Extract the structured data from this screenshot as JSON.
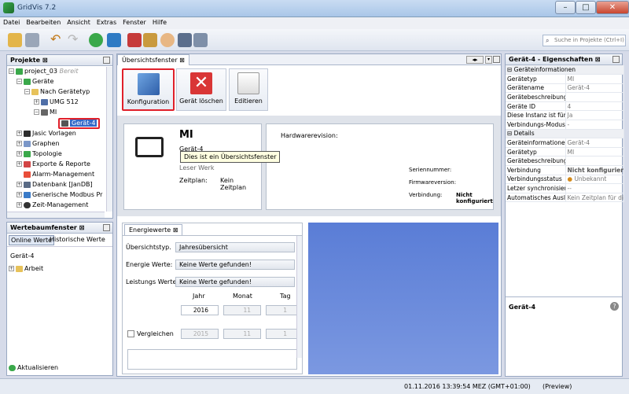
{
  "window": {
    "title": "GridVis 7.2",
    "min": "–",
    "max": "□",
    "close": "✕"
  },
  "menu": [
    "Datei",
    "Bearbeiten",
    "Ansicht",
    "Extras",
    "Fenster",
    "Hilfe"
  ],
  "search": {
    "placeholder": "Suche in Projekte (Ctrl+I)"
  },
  "projects": {
    "title": "Projekte",
    "tree": [
      {
        "label": "project_03",
        "suffix": "Bereit"
      },
      {
        "label": "Geräte"
      },
      {
        "label": "Nach Gerätetyp"
      },
      {
        "label": "UMG 512"
      },
      {
        "label": "MI"
      },
      {
        "label": "Gerät-4"
      },
      {
        "label": "Jasic Vorlagen"
      },
      {
        "label": "Graphen"
      },
      {
        "label": "Topologie"
      },
      {
        "label": "Exporte & Reporte"
      },
      {
        "label": "Alarm-Management"
      },
      {
        "label": "Datenbank [JanDB]"
      },
      {
        "label": "Generische Modbus Pr"
      },
      {
        "label": "Zeit-Management"
      }
    ]
  },
  "werte": {
    "title": "Wertebaumfenster",
    "tab_online": "Online Werte",
    "tab_hist": "Historische Werte",
    "device": "Gerät-4",
    "node": "Arbeit",
    "refresh": "Aktualisieren"
  },
  "overview": {
    "tab": "Übersichtsfenster",
    "btn_config": "Konfiguration",
    "btn_delete": "Gerät löschen",
    "btn_edit": "Editieren",
    "device_type": "MI",
    "device_name": "Gerät-4",
    "tooltip": "Dies ist ein Übersichtsfenster",
    "leser_label": "Leser Werk",
    "zeitplan_label": "Zeitplan:",
    "zeitplan_value": "Kein Zeitplan",
    "hw_label": "Hardwarerevision:",
    "serial_label": "Seriennummer:",
    "fw_label": "Firmwareversion:",
    "conn_label": "Verbindung:",
    "conn_value": "Nicht konfiguriert"
  },
  "energy": {
    "tab": "Energiewerte",
    "overview_label": "Übersichtstyp.",
    "overview_value": "Jahresübersicht",
    "energie_label": "Energie Werte:",
    "energie_value": "Keine Werte gefunden!",
    "leistung_label": "Leistungs Werte:",
    "leistung_value": "Keine Werte gefunden!",
    "col_jahr": "Jahr",
    "col_monat": "Monat",
    "col_tag": "Tag",
    "jahr": "2016",
    "monat": "11",
    "tag": "1",
    "compare_label": "Vergleichen",
    "cmp_jahr": "2015",
    "cmp_monat": "11",
    "cmp_tag": "1"
  },
  "props": {
    "title": "Gerät-4 - Eigenschaften",
    "section1": "Geräteinformationen",
    "rows1": [
      [
        "Gerätetyp",
        "MI"
      ],
      [
        "Gerätename",
        "Gerät-4"
      ],
      [
        "Gerätebeschreibung",
        ""
      ],
      [
        "Geräte ID",
        "4"
      ],
      [
        "Diese Instanz ist für",
        "Ja"
      ],
      [
        "Verbindungs-Modus",
        "-"
      ]
    ],
    "section2": "Details",
    "rows2": [
      [
        "Geräteinformationen",
        "Gerät-4"
      ],
      [
        "Gerätetyp",
        "MI"
      ],
      [
        "Gerätebeschreibung",
        ""
      ],
      [
        "Verbindung",
        "Nicht konfiguriert"
      ],
      [
        "Verbindungsstatus",
        "Unbekannt"
      ],
      [
        "Letzer synchronisier",
        "--"
      ],
      [
        "Automatisches Ausle",
        "Kein Zeitplan für diese"
      ]
    ],
    "footer": "Gerät-4"
  },
  "status": {
    "datetime": "01.11.2016 13:39:54 MEZ (GMT+01:00)",
    "mode": "(Preview)"
  },
  "colors": {
    "highlight": "#e0202a",
    "chartBlue": "#5d7fd6"
  }
}
